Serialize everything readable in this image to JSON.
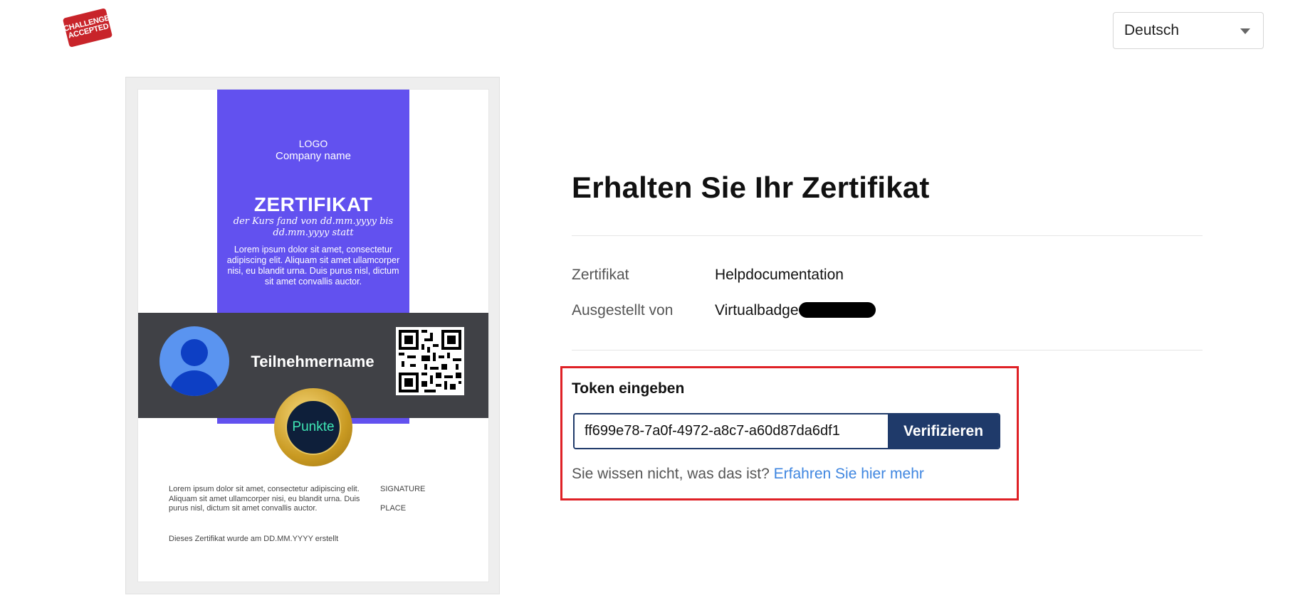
{
  "brand": {
    "logo_line1": "CHALLENGE",
    "logo_line2": "ACCEPTED",
    "logo_color": "#c8242a"
  },
  "language": {
    "selected": "Deutsch"
  },
  "certificate_preview": {
    "logo": "LOGO",
    "company": "Company name",
    "title": "ZERTIFIKAT",
    "subtitle": "der Kurs fand von dd.mm.yyyy bis dd.mm.yyyy statt",
    "lorem": "Lorem ipsum dolor sit amet, consectetur adipiscing elit. Aliquam sit amet ullamcorper nisi, eu blandit urna. Duis purus nisl, dictum sit amet convallis auctor.",
    "participant": "Teilnehmername",
    "medal": "Punkte",
    "footer_lorem": "Lorem ipsum dolor sit amet, consectetur adipiscing elit. Aliquam sit amet ullamcorper nisi, eu blandit urna. Duis purus nisl, dictum sit amet convallis auctor.",
    "signature": "SIGNATURE",
    "place": "PLACE",
    "created": "Dieses Zertifikat wurde am DD.MM.YYYY erstellt",
    "colors": {
      "band": "#6251ef",
      "bar": "#404146"
    }
  },
  "main": {
    "title": "Erhalten Sie Ihr Zertifikat",
    "info": [
      {
        "label": "Zertifikat",
        "value": "Helpdocumentation"
      },
      {
        "label": "Ausgestellt von",
        "value": "Virtualbadge"
      }
    ],
    "token": {
      "label": "Token eingeben",
      "value": "ff699e78-7a0f-4972-a8c7-a60d87da6df1",
      "button": "Verifizieren",
      "help_text": "Sie wissen nicht, was das ist?",
      "help_link": "Erfahren Sie hier mehr"
    },
    "colors": {
      "primary": "#1f3a6a",
      "highlight": "#df2126",
      "link": "#3f86e0"
    }
  }
}
